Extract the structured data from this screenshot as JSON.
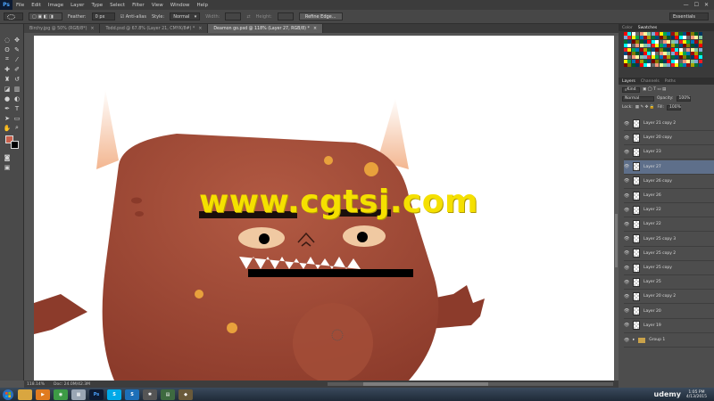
{
  "app": {
    "logo": "Ps"
  },
  "menu": [
    "File",
    "Edit",
    "Image",
    "Layer",
    "Type",
    "Select",
    "Filter",
    "View",
    "Window",
    "Help"
  ],
  "window_controls": [
    "—",
    "☐",
    "✕"
  ],
  "options": {
    "feather_label": "Feather:",
    "feather_value": "0 px",
    "antialias_label": "Anti-alias",
    "style_label": "Style:",
    "style_value": "Normal",
    "width_label": "Width:",
    "height_label": "Height:",
    "refine_label": "Refine Edge...",
    "workspace": "Essentials"
  },
  "tabs": [
    {
      "label": "Birchy.jpg @ 50% (RGB/8*)",
      "close": "×"
    },
    {
      "label": "Todd.psd @ 67.8% (Layer 21, CMYK/8#) *",
      "close": "×"
    },
    {
      "label": "Deamon go.psd @ 118% (Layer 27, RGB/8) *",
      "close": "×",
      "active": true
    }
  ],
  "status": {
    "zoom": "118.14%",
    "doc": "Doc: 24.0M/42.3M"
  },
  "watermark": "www.cgtsj.com",
  "panels": {
    "color_tabs": [
      "Color",
      "Swatches"
    ],
    "layer_tabs": [
      "Layers",
      "Channels",
      "Paths"
    ],
    "kind_label": "Kind",
    "blend_mode": "Normal",
    "opacity_label": "Opacity:",
    "opacity_value": "100%",
    "lock_label": "Lock:",
    "fill_label": "Fill:",
    "fill_value": "100%"
  },
  "layers": [
    {
      "name": "Layer 21 copy 2"
    },
    {
      "name": "Layer 20 copy"
    },
    {
      "name": "Layer 23"
    },
    {
      "name": "Layer 27",
      "selected": true
    },
    {
      "name": "Layer 26 copy"
    },
    {
      "name": "Layer 26"
    },
    {
      "name": "Layer 22"
    },
    {
      "name": "Layer 22"
    },
    {
      "name": "Layer 25 copy 3"
    },
    {
      "name": "Layer 25 copy 2"
    },
    {
      "name": "Layer 25 copy"
    },
    {
      "name": "Layer 25"
    },
    {
      "name": "Layer 20 copy 2"
    },
    {
      "name": "Layer 20"
    },
    {
      "name": "Layer 19"
    },
    {
      "name": "Group 1",
      "group": true
    }
  ],
  "taskbar": {
    "icons": [
      "folder",
      "media",
      "chrome",
      "calendar",
      "ps",
      "skype",
      "s",
      "network",
      "terminal",
      "app"
    ],
    "time": "1:05 PM",
    "date": "4/13/2015",
    "udemy": "udemy"
  },
  "colors": {
    "foreground": "#c9604b",
    "background": "#000000",
    "monster_skin": "#a9503b",
    "monster_shade": "#8a3a2a",
    "horn": "#f5c9a6",
    "wart": "#e8a13c",
    "watermark": "#f5e000"
  }
}
